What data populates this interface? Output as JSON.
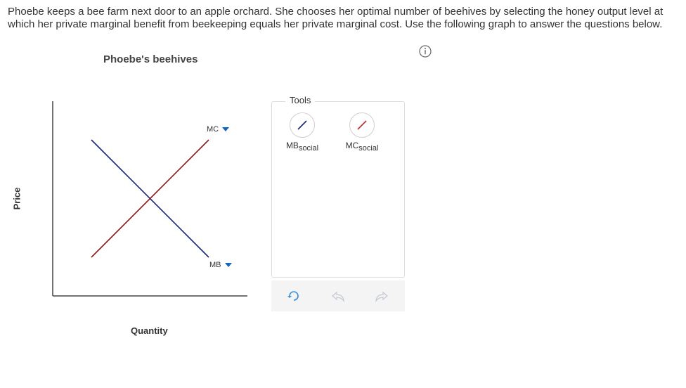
{
  "question": {
    "text": "Phoebe keeps a bee farm next door to an apple orchard. She chooses her optimal number of beehives by selecting the honey output level at which her private marginal benefit from beekeeping equals her private marginal cost. Use the following graph to answer the questions below."
  },
  "graph": {
    "title": "Phoebe's beehives",
    "y_axis_label": "Price",
    "x_axis_label": "Quantity",
    "curves": {
      "mc": {
        "label": "MC",
        "color": "#8b1a1a"
      },
      "mb": {
        "label": "MB",
        "color": "#1a237e"
      }
    },
    "accent_color": "#1565c0"
  },
  "tools": {
    "title": "Tools",
    "items": [
      {
        "base": "MB",
        "sub": "social",
        "color": "#1a237e"
      },
      {
        "base": "MC",
        "sub": "social",
        "color": "#c62828"
      }
    ]
  },
  "toolbar": {
    "icons": [
      "reset-icon",
      "undo-icon",
      "redo-icon"
    ]
  }
}
